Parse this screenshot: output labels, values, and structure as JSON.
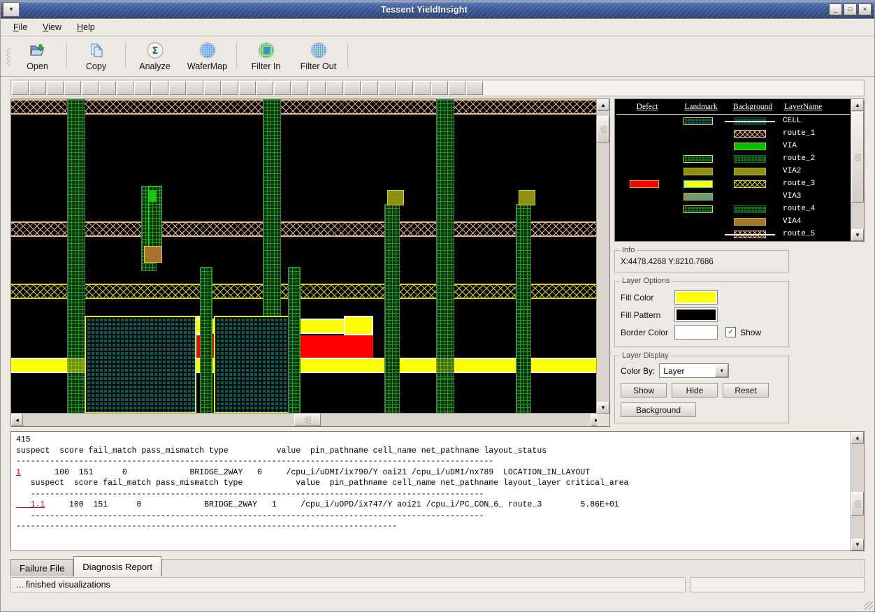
{
  "window": {
    "title": "Tessent YieldInsight",
    "sysmenu_icon": "chevron-down-icon",
    "minimize_label": "_",
    "maximize_label": "□",
    "close_label": "×"
  },
  "menubar": [
    {
      "label": "File",
      "mnemonic": "F"
    },
    {
      "label": "View",
      "mnemonic": "V"
    },
    {
      "label": "Help",
      "mnemonic": "H"
    }
  ],
  "toolbar": [
    {
      "label": "Open",
      "icon": "open-folder-icon"
    },
    {
      "label": "Copy",
      "icon": "copy-pages-icon"
    },
    {
      "label": "Analyze",
      "icon": "sigma-icon"
    },
    {
      "label": "WaferMap",
      "icon": "wafer-blue-icon"
    },
    {
      "label": "Filter In",
      "icon": "wafer-green-icon"
    },
    {
      "label": "Filter Out",
      "icon": "wafer-blue-green-icon"
    }
  ],
  "legend": {
    "headers": [
      "Defect",
      "Landmark",
      "Background",
      "LayerName"
    ],
    "rows": [
      {
        "name": "CELL",
        "defect": null,
        "landmark": "teal-hatch-yellowborder",
        "background": "teal-hatch-whiteline"
      },
      {
        "name": "route_1",
        "defect": null,
        "landmark": null,
        "background": "tan-crosshatch"
      },
      {
        "name": "VIA",
        "defect": null,
        "landmark": null,
        "background": "#00c000"
      },
      {
        "name": "route_2",
        "defect": null,
        "landmark": "green-hatch-yellowborder",
        "background": "green-hatch"
      },
      {
        "name": "VIA2",
        "defect": null,
        "landmark": "#8f8f16",
        "background": "#8f8f16"
      },
      {
        "name": "route_3",
        "defect": "#ff0000",
        "landmark": "#ffff00",
        "background": "yellow-crosshatch"
      },
      {
        "name": "VIA3",
        "defect": null,
        "landmark": "#6f9a78",
        "background": null
      },
      {
        "name": "route_4",
        "defect": null,
        "landmark": "green-hatch-yellowborder",
        "background": "green-hatch"
      },
      {
        "name": "VIA4",
        "defect": null,
        "landmark": null,
        "background": "#a9702f"
      },
      {
        "name": "route_5",
        "defect": null,
        "landmark": null,
        "background": "tan-crosshatch-whiteline"
      }
    ]
  },
  "info": {
    "group_title": "Info",
    "coords": "X:4478.4268 Y:8210.7686"
  },
  "layer_options": {
    "group_title": "Layer Options",
    "fill_color_label": "Fill Color",
    "fill_color_value": "#ffff00",
    "fill_pattern_label": "Fill Pattern",
    "fill_pattern_value": "#000000",
    "border_color_label": "Border Color",
    "border_color_value": "#ffffff",
    "show_label": "Show",
    "show_checked": true,
    "check_glyph": "✓"
  },
  "layer_display": {
    "group_title": "Layer Display",
    "color_by_label": "Color By:",
    "color_by_value": "Layer",
    "color_by_arrow": "chevron-down-icon",
    "buttons": [
      "Show",
      "Hide",
      "Reset",
      "Background"
    ]
  },
  "report": {
    "lines": [
      {
        "text": "415"
      },
      {
        "text": "suspect  score fail_match pass_mismatch type          value  pin_pathname cell_name net_pathname layout_status"
      },
      {
        "text": "---------------------------------------------------------------------------------------------------"
      },
      {
        "prefix": "1",
        "prefix_link": true,
        "text": "       100  151      0             BRIDGE_2WAY   0     /cpu_i/uDMI/ix790/Y oai21 /cpu_i/uDMI/nx789  LOCATION_IN_LAYOUT"
      },
      {
        "text": "   suspect  score fail_match pass_mismatch type           value  pin_pathname cell_name net_pathname layout_layer critical_area"
      },
      {
        "text": "   ----------------------------------------------------------------------------------------------"
      },
      {
        "prefix": "   1.1",
        "prefix_link": true,
        "text": "     100  151      0             BRIDGE_2WAY   1     /cpu_i/uOPD/ix747/Y aoi21 /cpu_i/PC_CON_6_ route_3        5.86E+01"
      },
      {
        "text": "   ----------------------------------------------------------------------------------------------"
      },
      {
        "text": "-------------------------------------------------------------------------------"
      }
    ]
  },
  "tabs": [
    {
      "label": "Failure File",
      "selected": false
    },
    {
      "label": "Diagnosis Report",
      "selected": true
    }
  ],
  "statusbar": {
    "message": "... finished visualizations"
  },
  "scrollbars": {
    "up_arrow": "▲",
    "down_arrow": "▼",
    "left_arrow": "◄",
    "right_arrow": "►"
  },
  "segment_strip": {
    "count": 27
  }
}
